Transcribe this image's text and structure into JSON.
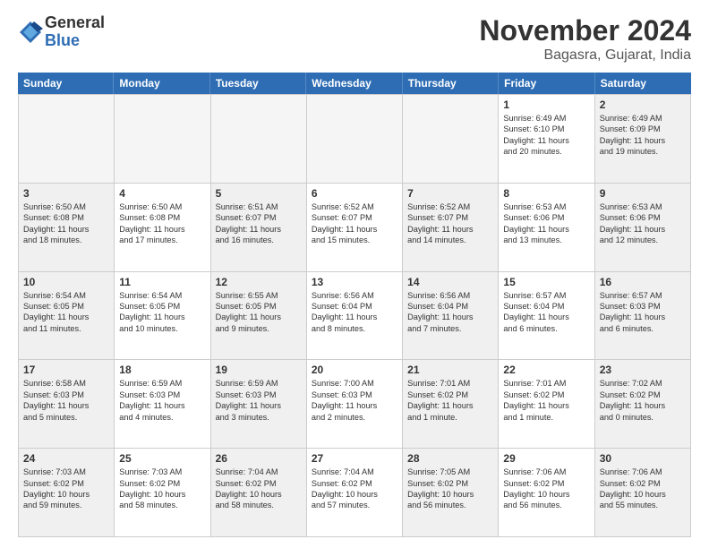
{
  "header": {
    "logo_general": "General",
    "logo_blue": "Blue",
    "month": "November 2024",
    "location": "Bagasra, Gujarat, India"
  },
  "weekdays": [
    "Sunday",
    "Monday",
    "Tuesday",
    "Wednesday",
    "Thursday",
    "Friday",
    "Saturday"
  ],
  "weeks": [
    [
      {
        "day": "",
        "info": ""
      },
      {
        "day": "",
        "info": ""
      },
      {
        "day": "",
        "info": ""
      },
      {
        "day": "",
        "info": ""
      },
      {
        "day": "",
        "info": ""
      },
      {
        "day": "1",
        "info": "Sunrise: 6:49 AM\nSunset: 6:10 PM\nDaylight: 11 hours\nand 20 minutes."
      },
      {
        "day": "2",
        "info": "Sunrise: 6:49 AM\nSunset: 6:09 PM\nDaylight: 11 hours\nand 19 minutes."
      }
    ],
    [
      {
        "day": "3",
        "info": "Sunrise: 6:50 AM\nSunset: 6:08 PM\nDaylight: 11 hours\nand 18 minutes."
      },
      {
        "day": "4",
        "info": "Sunrise: 6:50 AM\nSunset: 6:08 PM\nDaylight: 11 hours\nand 17 minutes."
      },
      {
        "day": "5",
        "info": "Sunrise: 6:51 AM\nSunset: 6:07 PM\nDaylight: 11 hours\nand 16 minutes."
      },
      {
        "day": "6",
        "info": "Sunrise: 6:52 AM\nSunset: 6:07 PM\nDaylight: 11 hours\nand 15 minutes."
      },
      {
        "day": "7",
        "info": "Sunrise: 6:52 AM\nSunset: 6:07 PM\nDaylight: 11 hours\nand 14 minutes."
      },
      {
        "day": "8",
        "info": "Sunrise: 6:53 AM\nSunset: 6:06 PM\nDaylight: 11 hours\nand 13 minutes."
      },
      {
        "day": "9",
        "info": "Sunrise: 6:53 AM\nSunset: 6:06 PM\nDaylight: 11 hours\nand 12 minutes."
      }
    ],
    [
      {
        "day": "10",
        "info": "Sunrise: 6:54 AM\nSunset: 6:05 PM\nDaylight: 11 hours\nand 11 minutes."
      },
      {
        "day": "11",
        "info": "Sunrise: 6:54 AM\nSunset: 6:05 PM\nDaylight: 11 hours\nand 10 minutes."
      },
      {
        "day": "12",
        "info": "Sunrise: 6:55 AM\nSunset: 6:05 PM\nDaylight: 11 hours\nand 9 minutes."
      },
      {
        "day": "13",
        "info": "Sunrise: 6:56 AM\nSunset: 6:04 PM\nDaylight: 11 hours\nand 8 minutes."
      },
      {
        "day": "14",
        "info": "Sunrise: 6:56 AM\nSunset: 6:04 PM\nDaylight: 11 hours\nand 7 minutes."
      },
      {
        "day": "15",
        "info": "Sunrise: 6:57 AM\nSunset: 6:04 PM\nDaylight: 11 hours\nand 6 minutes."
      },
      {
        "day": "16",
        "info": "Sunrise: 6:57 AM\nSunset: 6:03 PM\nDaylight: 11 hours\nand 6 minutes."
      }
    ],
    [
      {
        "day": "17",
        "info": "Sunrise: 6:58 AM\nSunset: 6:03 PM\nDaylight: 11 hours\nand 5 minutes."
      },
      {
        "day": "18",
        "info": "Sunrise: 6:59 AM\nSunset: 6:03 PM\nDaylight: 11 hours\nand 4 minutes."
      },
      {
        "day": "19",
        "info": "Sunrise: 6:59 AM\nSunset: 6:03 PM\nDaylight: 11 hours\nand 3 minutes."
      },
      {
        "day": "20",
        "info": "Sunrise: 7:00 AM\nSunset: 6:03 PM\nDaylight: 11 hours\nand 2 minutes."
      },
      {
        "day": "21",
        "info": "Sunrise: 7:01 AM\nSunset: 6:02 PM\nDaylight: 11 hours\nand 1 minute."
      },
      {
        "day": "22",
        "info": "Sunrise: 7:01 AM\nSunset: 6:02 PM\nDaylight: 11 hours\nand 1 minute."
      },
      {
        "day": "23",
        "info": "Sunrise: 7:02 AM\nSunset: 6:02 PM\nDaylight: 11 hours\nand 0 minutes."
      }
    ],
    [
      {
        "day": "24",
        "info": "Sunrise: 7:03 AM\nSunset: 6:02 PM\nDaylight: 10 hours\nand 59 minutes."
      },
      {
        "day": "25",
        "info": "Sunrise: 7:03 AM\nSunset: 6:02 PM\nDaylight: 10 hours\nand 58 minutes."
      },
      {
        "day": "26",
        "info": "Sunrise: 7:04 AM\nSunset: 6:02 PM\nDaylight: 10 hours\nand 58 minutes."
      },
      {
        "day": "27",
        "info": "Sunrise: 7:04 AM\nSunset: 6:02 PM\nDaylight: 10 hours\nand 57 minutes."
      },
      {
        "day": "28",
        "info": "Sunrise: 7:05 AM\nSunset: 6:02 PM\nDaylight: 10 hours\nand 56 minutes."
      },
      {
        "day": "29",
        "info": "Sunrise: 7:06 AM\nSunset: 6:02 PM\nDaylight: 10 hours\nand 56 minutes."
      },
      {
        "day": "30",
        "info": "Sunrise: 7:06 AM\nSunset: 6:02 PM\nDaylight: 10 hours\nand 55 minutes."
      }
    ]
  ]
}
